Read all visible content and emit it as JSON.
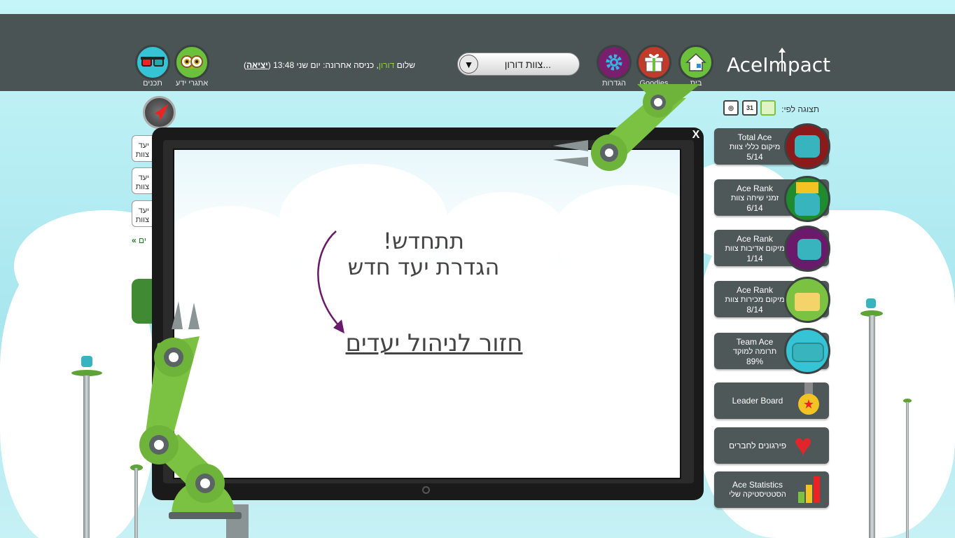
{
  "app": {
    "logo": "AceImpact"
  },
  "nav": {
    "home_label": "בית",
    "goodies_label": "Goodies",
    "settings_label": "הגדרות",
    "knowledge_label": "אתגרי ידע",
    "content_label": "תכנים"
  },
  "team_select": {
    "value": "צוות דורון...",
    "arrow": "▼"
  },
  "greeting": {
    "prefix": "שלום",
    "name": "דורון",
    "last_login": ", כניסה אחרונה: יום שני 13:48 (",
    "logout": "יציאה",
    "suffix": ")"
  },
  "view_by": {
    "label": "תצוגה לפי:",
    "cal_day": "31"
  },
  "stats_cards": [
    {
      "title": "Total Ace",
      "subtitle": "מיקום כללי צוות",
      "value": "5/14",
      "badge_color": "#8b1a1a"
    },
    {
      "title": "Ace Rank",
      "subtitle": "זמני שיחה צוות",
      "value": "6/14",
      "badge_color": "#1f8a2e"
    },
    {
      "title": "Ace Rank",
      "subtitle": "מיקום אדיבות צוות",
      "value": "1/14",
      "badge_color": "#6a1a6a"
    },
    {
      "title": "Ace Rank",
      "subtitle": "מיקום מכירות צוות",
      "value": "8/14",
      "badge_color": "#7cc242"
    },
    {
      "title": "Team Ace",
      "subtitle": "תרומה למוקד",
      "value": "89%",
      "badge_color": "#37c3d6"
    }
  ],
  "menu_cards": [
    {
      "label": "Leader Board"
    },
    {
      "label": "פירגונים לחברים"
    },
    {
      "label": "Ace Statistics",
      "sublabel": "הסטטיסטיקה שלי"
    }
  ],
  "left_buttons": [
    "יעד\nצוות",
    "יעד\nצוות",
    "יעד\nצוות"
  ],
  "left_link": "ים",
  "modal": {
    "close": "X",
    "heading_line1": "תתחדש!",
    "heading_line2": "הגדרת יעד חדש",
    "back_link": "חזור לניהול יעדים"
  },
  "colors": {
    "topbar": "#4b5454",
    "accent_green": "#8ed23c",
    "arrow_purple": "#6a1a6a"
  }
}
